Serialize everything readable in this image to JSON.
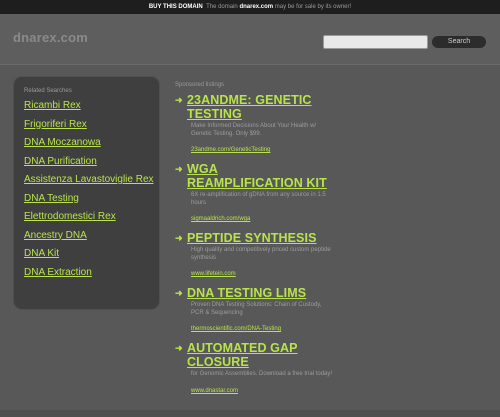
{
  "topbar": {
    "buy_label": "BUY THIS DOMAIN",
    "text_before": "The domain",
    "domain": "dnarex.com",
    "text_after": "may be for sale by its owner!"
  },
  "header": {
    "logo": "dnarex.com",
    "search_placeholder": "",
    "search_button": "Search"
  },
  "sidebar": {
    "title": "Related Searches",
    "items": [
      "Ricambi Rex",
      "Frigoriferi Rex",
      "DNA Moczanowa",
      "DNA Purification",
      "Assistenza Lavastoviglie Rex",
      "DNA Testing",
      "Elettrodomestici Rex",
      "Ancestry DNA",
      "DNA Kit",
      "DNA Extraction"
    ]
  },
  "main": {
    "sponsored_label": "Sponsored listings",
    "listings": [
      {
        "title": "23ANDME: GENETIC TESTING",
        "desc": "Make Informed Decisions About Your Health w/ Genetic Testing. Only $99.",
        "url": "23andme.com/GeneticTesting"
      },
      {
        "title": "WGA REAMPLIFICATION KIT",
        "desc": "6X re-amplification of gDNA from any source in 1.5 hours",
        "url": "sigmaaldrich.com/wga"
      },
      {
        "title": "PEPTIDE SYNTHESIS",
        "desc": "High quality and competitively priced custom peptide synthesis",
        "url": "www.lifetein.com"
      },
      {
        "title": "DNA TESTING LIMS",
        "desc": "Proven DNA Testing Solutions: Chain of Custody, PCR & Sequencing",
        "url": "thermoscientific.com/DNA-Testing"
      },
      {
        "title": "AUTOMATED GAP CLOSURE",
        "desc": "for Genomic Assemblies. Download a free trial today!",
        "url": "www.dnastar.com"
      }
    ]
  },
  "colors": {
    "background": "#585858",
    "accent_green": "#b9e34a",
    "topbar": "#1e1e1e",
    "sidebar": "#3f3f3f"
  }
}
